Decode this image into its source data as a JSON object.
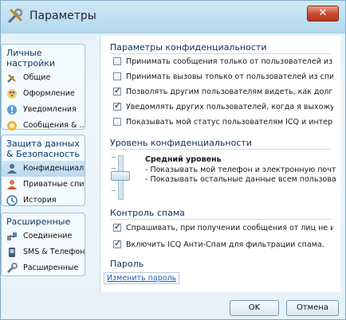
{
  "window": {
    "title": "Параметры"
  },
  "sidebar": {
    "groups": [
      {
        "header": "Личные настройки",
        "items": [
          {
            "label": "Общие",
            "icon": "tools-icon"
          },
          {
            "label": "Оформление",
            "icon": "palette-icon"
          },
          {
            "label": "Уведомления",
            "icon": "notification-icon"
          },
          {
            "label": "Сообщения & ...",
            "icon": "messages-icon"
          }
        ]
      },
      {
        "header": "Защита данных & Безопасность",
        "items": [
          {
            "label": "Конфиденциал...",
            "icon": "privacy-icon",
            "active": true
          },
          {
            "label": "Приватные спи...",
            "icon": "contacts-icon"
          },
          {
            "label": "История",
            "icon": "history-icon"
          }
        ]
      },
      {
        "header": "Расширенные",
        "items": [
          {
            "label": "Соединение",
            "icon": "connection-icon"
          },
          {
            "label": "SMS & Телефон",
            "icon": "sms-icon"
          },
          {
            "label": "Расширенные",
            "icon": "advanced-icon"
          }
        ]
      }
    ]
  },
  "privacy": {
    "title": "Параметры конфиденциальности",
    "options": [
      {
        "label": "Принимать сообщения только от пользователей из списка конт...",
        "checked": false
      },
      {
        "label": "Принимать вызовы только от пользователей из списка контактов",
        "checked": false
      },
      {
        "label": "Позволять другим пользователям видеть, как долго я неактивен",
        "checked": true
      },
      {
        "label": "Уведомлять других пользователей, когда я выхожу из переписки",
        "checked": true
      },
      {
        "label": "Показывать мой статус пользователям ICQ и интернета",
        "checked": false
      }
    ]
  },
  "level": {
    "title": "Уровень конфиденциальности",
    "name": "Средний уровень",
    "lines": [
      "- Показывать мой телефон и электронную почту пользова...",
      "- Показывать остальные данные всем пользователям"
    ]
  },
  "spam": {
    "title": "Контроль спама",
    "options": [
      {
        "label": "Спрашивать, при получении сообщения от лиц не из списка конта...",
        "checked": true
      },
      {
        "label": "Включить ICQ Анти-Спам для фильтрации спама.",
        "checked": true
      }
    ]
  },
  "password": {
    "title": "Пароль",
    "link": "Изменить пароль"
  },
  "buttons": {
    "ok": "OK",
    "cancel": "Отмена"
  }
}
